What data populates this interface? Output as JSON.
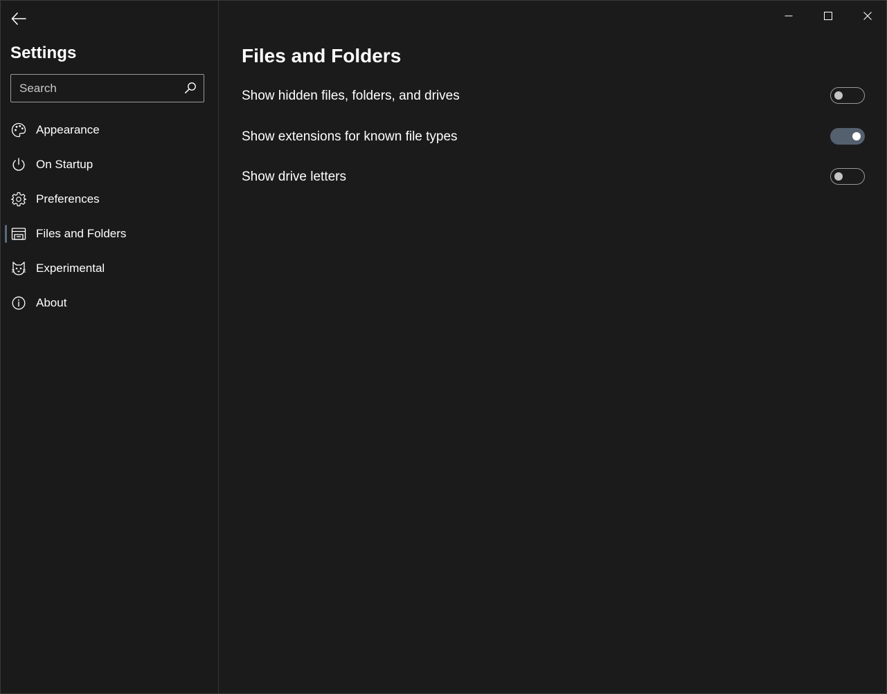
{
  "sidebar": {
    "title": "Settings",
    "search": {
      "placeholder": "Search",
      "value": ""
    },
    "items": [
      {
        "label": "Appearance",
        "icon": "palette-icon"
      },
      {
        "label": "On Startup",
        "icon": "power-icon"
      },
      {
        "label": "Preferences",
        "icon": "gear-icon"
      },
      {
        "label": "Files and Folders",
        "icon": "drive-icon",
        "selected": true
      },
      {
        "label": "Experimental",
        "icon": "cat-icon"
      },
      {
        "label": "About",
        "icon": "info-icon"
      }
    ]
  },
  "main": {
    "title": "Files and Folders",
    "settings": [
      {
        "label": "Show hidden files, folders, and drives",
        "enabled": false
      },
      {
        "label": "Show extensions for known file types",
        "enabled": true
      },
      {
        "label": "Show drive letters",
        "enabled": false
      }
    ]
  },
  "colors": {
    "background": "#1b1b1b",
    "toggle_on": "#55606e",
    "selection_indicator": "#5c6a7c",
    "text": "#ffffff"
  }
}
